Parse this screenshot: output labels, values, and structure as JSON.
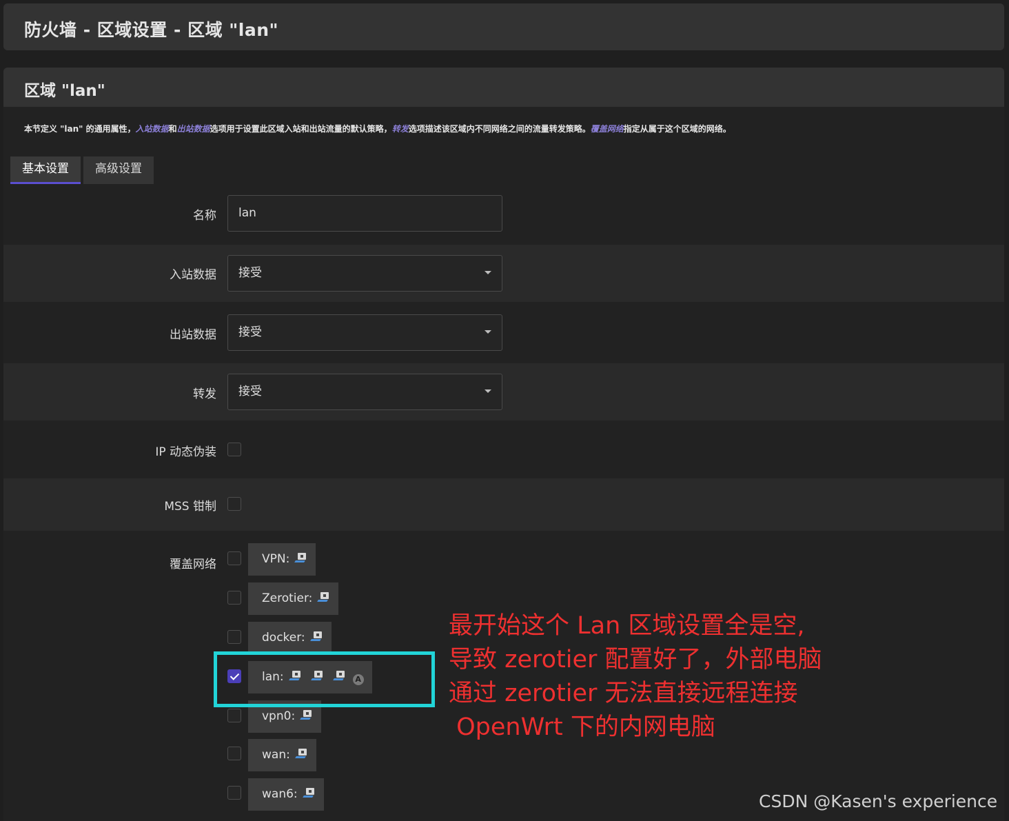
{
  "page_title": "防火墙 - 区域设置 - 区域 \"lan\"",
  "section": {
    "title": "区域 \"lan\"",
    "description": {
      "part1": "本节定义 \"lan\" 的通用属性，",
      "link1": "入站数据",
      "part2": "和",
      "link2": "出站数据",
      "part3": "选项用于设置此区域入站和出站流量的默认策略，",
      "link3": "转发",
      "part4": "选项描述该区域内不同网络之间的流量转发策略。",
      "link4": "覆盖网络",
      "part5": "指定从属于这个区域的网络。"
    }
  },
  "tabs": [
    {
      "label": "基本设置",
      "active": true
    },
    {
      "label": "高级设置",
      "active": false
    }
  ],
  "fields": {
    "name": {
      "label": "名称",
      "value": "lan"
    },
    "input": {
      "label": "入站数据",
      "value": "接受"
    },
    "output": {
      "label": "出站数据",
      "value": "接受"
    },
    "forward": {
      "label": "转发",
      "value": "接受"
    },
    "masq": {
      "label": "IP 动态伪装",
      "checked": false
    },
    "mss": {
      "label": "MSS 钳制",
      "checked": false
    },
    "covered_networks": {
      "label": "覆盖网络",
      "items": [
        {
          "name": "VPN:",
          "checked": false,
          "icons": [
            "network-interface-icon"
          ]
        },
        {
          "name": "Zerotier:",
          "checked": false,
          "icons": [
            "network-interface-icon"
          ]
        },
        {
          "name": "docker:",
          "checked": false,
          "icons": [
            "network-interface-icon"
          ]
        },
        {
          "name": "lan:",
          "checked": true,
          "icons": [
            "network-interface-icon",
            "network-interface-icon",
            "network-interface-icon",
            "wireless-icon"
          ]
        },
        {
          "name": "vpn0:",
          "checked": false,
          "icons": [
            "network-interface-icon"
          ]
        },
        {
          "name": "wan:",
          "checked": false,
          "icons": [
            "network-interface-icon"
          ]
        },
        {
          "name": "wan6:",
          "checked": false,
          "icons": [
            "network-interface-icon"
          ]
        }
      ]
    }
  },
  "annotation": {
    "color": "#ee3030",
    "lines": [
      "最开始这个 Lan 区域设置全是空,",
      "导致 zerotier 配置好了，外部电脑",
      "通过 zerotier 无法直接远程连接",
      " OpenWrt 下的内网电脑"
    ]
  },
  "highlight_color": "#22d4d8",
  "accent_color": "#5b4fd0",
  "watermark": "CSDN @Kasen's experience"
}
